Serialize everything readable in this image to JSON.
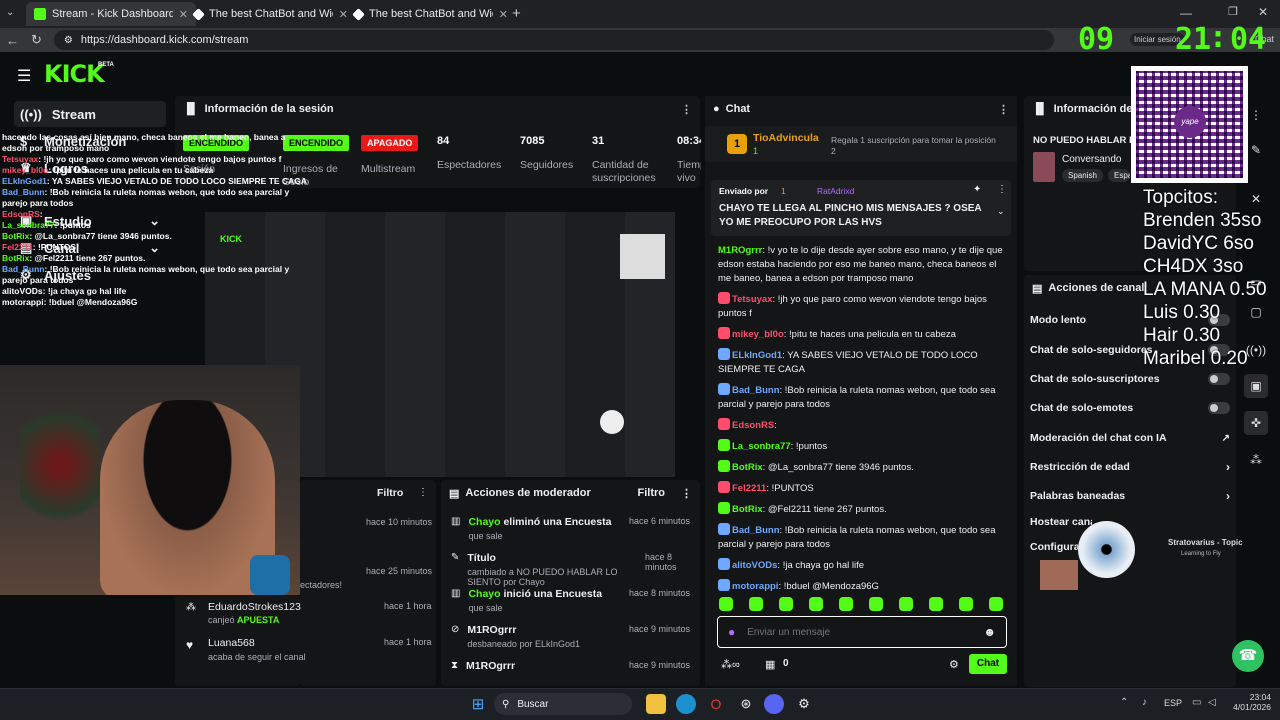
{
  "browser": {
    "tabs": [
      {
        "title": "Stream - Kick Dashboard",
        "active": true,
        "color": "#53fc18"
      },
      {
        "title": "The best ChatBot and Widgets for",
        "active": false,
        "color": "#ffffff"
      },
      {
        "title": "The best ChatBot and Widgets for",
        "active": false,
        "color": "#ffffff"
      }
    ],
    "url": "https://dashboard.kick.com/stream",
    "signin_label": "Iniciar sesión",
    "chat_label": "Chat"
  },
  "clock": {
    "h": "09",
    "m": "21",
    "s": "04"
  },
  "brand": {
    "logo": "KICK",
    "beta": "BETA",
    "accent": "#53fc18"
  },
  "sidebar": {
    "items": [
      {
        "label": "Stream"
      },
      {
        "label": "Monetización"
      },
      {
        "label": "Logros"
      },
      {
        "label": "Estudio"
      },
      {
        "label": "Canal"
      },
      {
        "label": "Ajustes"
      }
    ]
  },
  "session": {
    "title": "Información de la sesión",
    "stats": [
      {
        "value": "ENCENDIDO",
        "label": "Sesión"
      },
      {
        "value": "ENCENDIDO",
        "label": "Ingresos de Socio"
      },
      {
        "value": "APAGADO",
        "label": "Multistream"
      },
      {
        "value": "84",
        "label": "Espectadores"
      },
      {
        "value": "7085",
        "label": "Seguidores"
      },
      {
        "value": "31",
        "label": "Cantidad de suscripciones"
      },
      {
        "value": "08:34",
        "label": "Tiempo en vivo"
      }
    ]
  },
  "overlay_chat": [
    {
      "user": "",
      "text": "hacendo las cosas así bien mano, checa baneos el me baneo, banea a edson por tramposo mano"
    },
    {
      "user": "Tetsuyax",
      "text": "!jh yo que paro como wevon viendote tengo bajos puntos f"
    },
    {
      "user": "mikey_bl0o",
      "text": "!pitu te haces una pelicula en tu cabeza"
    },
    {
      "user": "ELkInGod1",
      "text": "YA SABES VIEJO VETALO DE TODO LOCO SIEMPRE TE CAGA"
    },
    {
      "user": "Bad_Bunn",
      "text": "!Bob reinicia la ruleta nomas webon, que todo sea parcial y parejo para todos"
    },
    {
      "user": "EdsonRS",
      "text": ""
    },
    {
      "user": "La_sonbra77",
      "text": "!puntos"
    },
    {
      "user": "BotRix",
      "text": "@La_sonbra77 tiene 3946 puntos."
    },
    {
      "user": "Fel2211",
      "text": "!PUNTOS"
    },
    {
      "user": "BotRix",
      "text": "@Fel2211 tiene 267 puntos."
    },
    {
      "user": "Bad_Bunn",
      "text": "!Bob reinicia la ruleta nomas webon, que todo sea parcial y parejo para todos"
    },
    {
      "user": "alitoVODs",
      "text": "!ja chaya go hal life"
    },
    {
      "user": "motorappi",
      "text": "!bduel @Mendoza96G"
    }
  ],
  "activity": {
    "filter_label": "Filtro",
    "items": [
      {
        "name": "",
        "sub": "",
        "time": "hace 10 minutos"
      },
      {
        "name": "",
        "sub": "ectadores!",
        "time": "hace 25 minutos"
      },
      {
        "name": "EduardoStrokes123",
        "sub": "canjeó",
        "tag": "APUESTA",
        "time": "hace 1 hora"
      },
      {
        "name": "Luana568",
        "sub": "acaba de seguir el canal",
        "time": "hace 1 hora"
      }
    ]
  },
  "modactions": {
    "title": "Acciones de moderador",
    "filter_label": "Filtro",
    "items": [
      {
        "actor": "Chayo",
        "action": "eliminó una Encuesta",
        "sub": "que sale",
        "time": "hace 6 minutos"
      },
      {
        "actor": "",
        "action": "Título",
        "sub": "cambiado a NO PUEDO HABLAR LO SIENTO por Chayo",
        "time": "hace 8 minutos"
      },
      {
        "actor": "Chayo",
        "action": "inició una Encuesta",
        "sub": "que sale",
        "time": "hace 8 minutos"
      },
      {
        "actor": "",
        "action": "M1ROgrrr",
        "sub": "desbaneado por ELkInGod1",
        "time": "hace 9 minutos"
      },
      {
        "actor": "",
        "action": "M1ROgrrr",
        "sub": "",
        "time": "hace 9 minutos"
      }
    ]
  },
  "chat": {
    "title": "Chat",
    "gift_user": "TioAdvincula",
    "gift_text": "Regala 1 suscripción para tomar la posición 2",
    "gift_count": "1",
    "top_rank": "1",
    "top_user": "RatAdrixd",
    "pinned_label": "Enviado por",
    "pinned_text": "CHAYO TE LLEGA AL PINCHO MIS MENSAJES ? OSEA YO ME PREOCUPO POR LAS HVS",
    "messages": [
      {
        "user": "M1ROgrrr",
        "color": "#53fc18",
        "text": "!v yo te lo dije desde ayer sobre eso mano, y te dije que edson estaba haciendo por eso me baneo mano, checa baneos el me baneo, banea a edson por tramposo mano"
      },
      {
        "user": "Tetsuyax",
        "color": "#ff4d6d",
        "text": "!jh yo que paro como wevon viendote tengo bajos puntos f"
      },
      {
        "user": "mikey_bl0o",
        "color": "#ff4d6d",
        "text": "!pitu te haces una pelicula en tu cabeza"
      },
      {
        "user": "ELkInGod1",
        "color": "#6ea8ff",
        "text": "YA SABES VIEJO VETALO DE TODO LOCO SIEMPRE TE CAGA"
      },
      {
        "user": "Bad_Bunn",
        "color": "#6ea8ff",
        "text": "!Bob reinicia la ruleta nomas webon, que todo sea parcial y parejo para todos"
      },
      {
        "user": "EdsonRS",
        "color": "#ff4d6d",
        "text": ""
      },
      {
        "user": "La_sonbra77",
        "color": "#53fc18",
        "text": "!puntos"
      },
      {
        "user": "BotRix",
        "color": "#53fc18",
        "text": "@La_sonbra77 tiene 3946 puntos."
      },
      {
        "user": "Fel2211",
        "color": "#ff4d6d",
        "text": "!PUNTOS"
      },
      {
        "user": "BotRix",
        "color": "#53fc18",
        "text": "@Fel2211 tiene 267 puntos."
      },
      {
        "user": "Bad_Bunn",
        "color": "#6ea8ff",
        "text": "!Bob reinicia la ruleta nomas webon, que todo sea parcial y parejo para todos"
      },
      {
        "user": "alitoVODs",
        "color": "#6ea8ff",
        "text": "!ja chaya go hal life"
      },
      {
        "user": "motorappi",
        "color": "#6ea8ff",
        "text": "!bduel @Mendoza96G"
      }
    ],
    "input_placeholder": "Enviar un mensaje",
    "points": "0",
    "send_label": "Chat"
  },
  "stream_info": {
    "title": "Información del stream",
    "stream_title": "NO PUEDO HABLAR LO SIENTO",
    "category": "Conversando",
    "tags": [
      "Spanish",
      "Español"
    ]
  },
  "channel_actions": {
    "title": "Acciones de canal",
    "items": [
      {
        "label": "Modo lento",
        "kind": "toggle"
      },
      {
        "label": "Chat de solo-seguidores",
        "kind": "toggle"
      },
      {
        "label": "Chat de solo-suscriptores",
        "kind": "toggle"
      },
      {
        "label": "Chat de solo-emotes",
        "kind": "toggle"
      },
      {
        "label": "Moderación del chat con IA",
        "kind": "link"
      },
      {
        "label": "Restricción de edad",
        "kind": "chevron"
      },
      {
        "label": "Palabras baneadas",
        "kind": "chevron"
      },
      {
        "label": "Hostear canal",
        "kind": "none"
      },
      {
        "label": "Configuración",
        "kind": "none"
      }
    ]
  },
  "top_list": {
    "title": "Topcitos:",
    "rows": [
      "Brenden 35so",
      "DavidYC 6so",
      "CH4DX 3so",
      "LA MANA 0.50",
      "Luis 0.30",
      "Hair 0.30",
      "Maribel 0.20"
    ]
  },
  "music": {
    "title": "Stratovarius - Topic",
    "subtitle": "Learning to Fly"
  },
  "qr": {
    "label": "yape"
  },
  "taskbar": {
    "search_placeholder": "Buscar",
    "lang": "ESP",
    "time": "23:04",
    "date": "4/01/2026"
  }
}
